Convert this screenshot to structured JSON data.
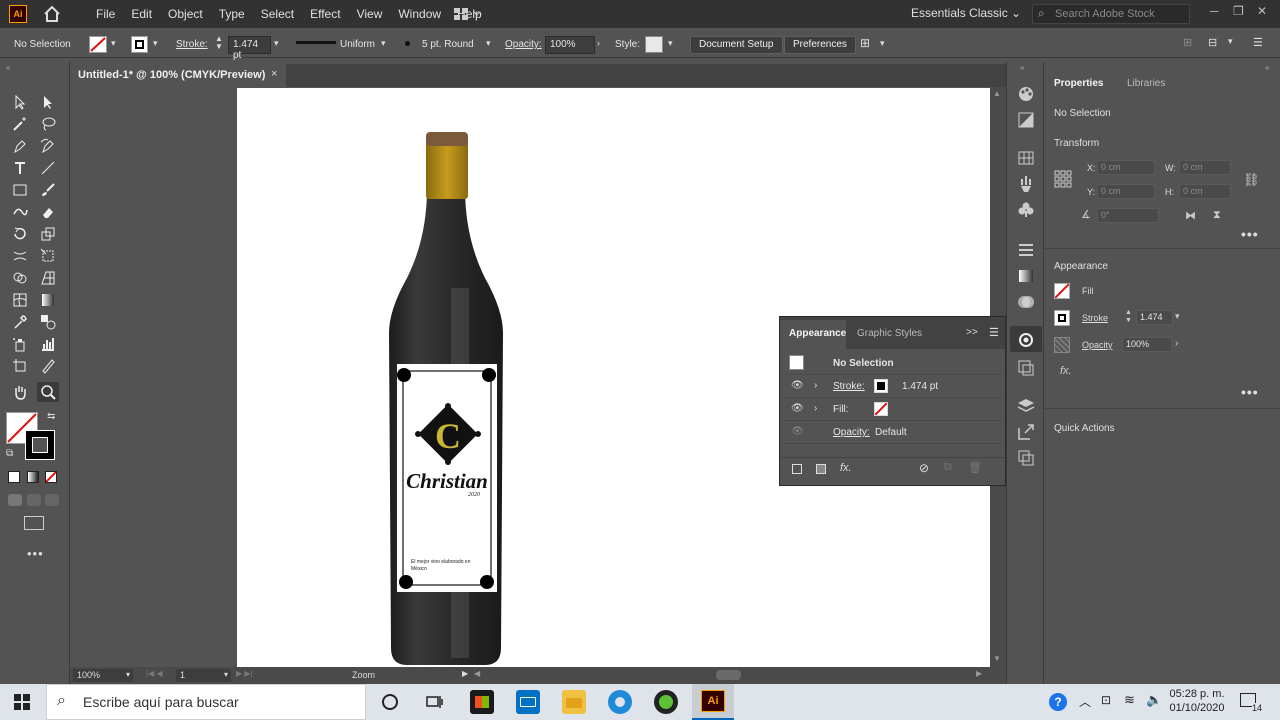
{
  "app": {
    "logo": "Ai"
  },
  "menu": [
    "File",
    "Edit",
    "Object",
    "Type",
    "Select",
    "Effect",
    "View",
    "Window",
    "Help"
  ],
  "workspace": "Essentials Classic",
  "search_stock": {
    "placeholder": "Search Adobe Stock"
  },
  "control": {
    "selection": "No Selection",
    "stroke_label": "Stroke:",
    "stroke_value": "1.474 pt",
    "profile": "Uniform",
    "brush": "5 pt. Round",
    "opacity_label": "Opacity:",
    "opacity_value": "100%",
    "style_label": "Style:",
    "document_setup": "Document Setup",
    "preferences": "Preferences"
  },
  "document_tab": {
    "title": "Untitled-1* @ 100% (CMYK/Preview)",
    "close": "×"
  },
  "artwork": {
    "brand": "Christian",
    "year": "2020",
    "logo_letter": "C",
    "tagline_1": "El mejor vino elaborado en",
    "tagline_2": "México"
  },
  "status": {
    "zoom": "100%",
    "page": "1",
    "tool": "Zoom"
  },
  "properties": {
    "tab_properties": "Properties",
    "tab_libraries": "Libraries",
    "selection": "No Selection",
    "transform_title": "Transform",
    "x_label": "X:",
    "y_label": "Y:",
    "w_label": "W:",
    "h_label": "H:",
    "x_value": "0 cm",
    "y_value": "0 cm",
    "w_value": "0 cm",
    "h_value": "0 cm",
    "angle_value": "0°",
    "appearance_title": "Appearance",
    "fill_label": "Fill",
    "stroke_label": "Stroke",
    "stroke_value": "1.474",
    "opacity_label": "Opacity",
    "opacity_value": "100%",
    "fx": "fx.",
    "quick_actions": "Quick Actions",
    "more": "•••"
  },
  "appearance_panel": {
    "tab_appearance": "Appearance",
    "tab_graphic_styles": "Graphic Styles",
    "collapse": ">>",
    "header": "No Selection",
    "stroke_label": "Stroke:",
    "stroke_value": "1.474 pt",
    "fill_label": "Fill:",
    "opacity_label": "Opacity:",
    "opacity_value": "Default",
    "fx": "fx."
  },
  "taskbar": {
    "search_placeholder": "Escribe aquí para buscar",
    "time": "05:28 p. m.",
    "date": "01/10/2020",
    "notifications": "14"
  },
  "colors": {
    "accent_orange": "#ff9a00",
    "bottle": "#2b2b2b",
    "cap": "#b8860b",
    "logo_gold": "#c9b637"
  }
}
